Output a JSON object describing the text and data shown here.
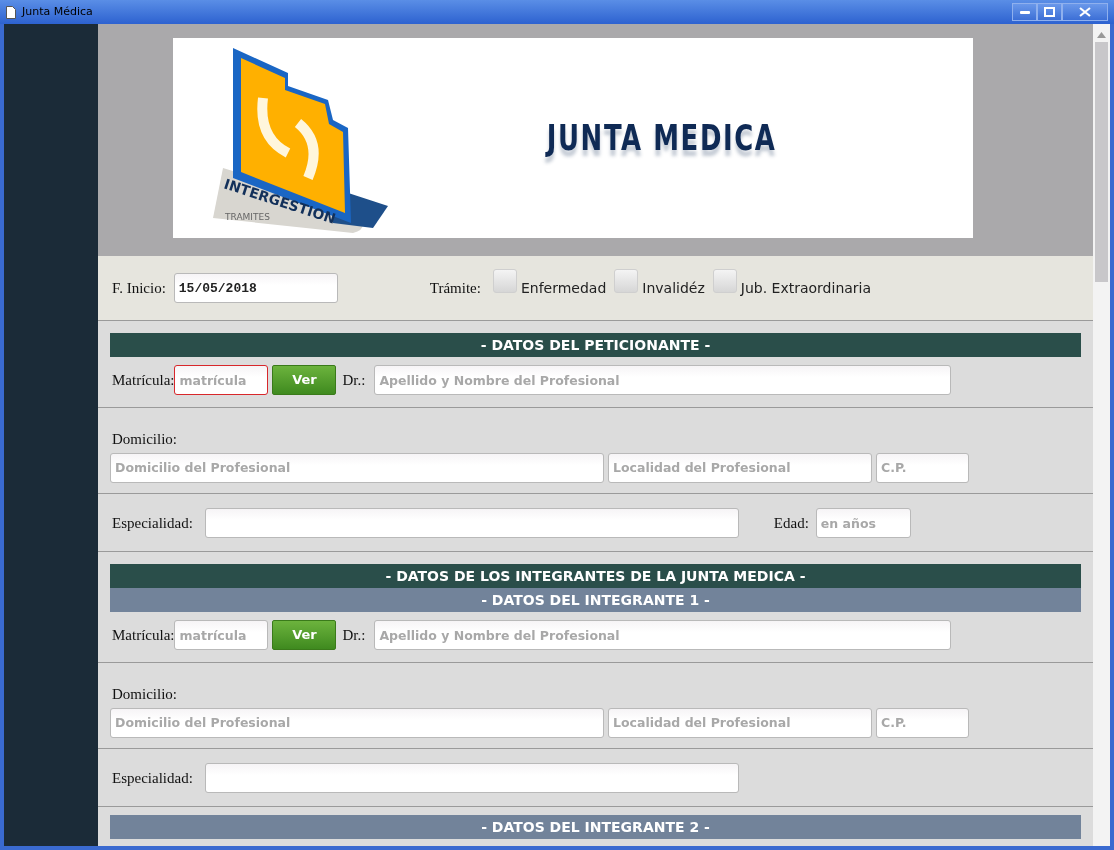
{
  "window": {
    "title": "Junta Médica"
  },
  "banner": {
    "logo_text": "INTERGESTION",
    "logo_subtext": "TRAMITES",
    "title": "JUNTA MEDICA"
  },
  "header": {
    "start_label": "F. Inicio:",
    "start_value": "15/05/2018",
    "tramite_label": "Trámite:",
    "options": [
      {
        "label": "Enfermedad",
        "checked": false
      },
      {
        "label": "Invalidéz",
        "checked": false
      },
      {
        "label": "Jub. Extraordinaria",
        "checked": false
      }
    ]
  },
  "rows": [
    {
      "kind": "matricula",
      "headings": [
        {
          "text": "- DATOS DEL PETICIONANTE -",
          "color": "#2a4e4a"
        }
      ],
      "label": "Matrícula:",
      "placeholder": "matrícula",
      "invalid": true,
      "button": "Ver",
      "dr_label": "Dr.:",
      "name_placeholder": "Apellido y Nombre del Profesional"
    },
    {
      "kind": "address",
      "label": "Domicilio:",
      "placeholders": [
        "Domicilio del Profesional",
        "Localidad del Profesional",
        "C.P."
      ]
    },
    {
      "kind": "specialty",
      "label": "Especialidad:",
      "age_label": "Edad:",
      "age_placeholder": "en años"
    },
    {
      "kind": "matricula",
      "headings": [
        {
          "text": "- DATOS DE LOS INTEGRANTES DE LA JUNTA MEDICA -",
          "color": "#2a4e4a"
        },
        {
          "text": "- DATOS DEL INTEGRANTE 1 -",
          "color": "#72839a"
        }
      ],
      "label": "Matrícula:",
      "placeholder": "matrícula",
      "invalid": false,
      "button": "Ver",
      "dr_label": "Dr.:",
      "name_placeholder": "Apellido y Nombre del Profesional"
    },
    {
      "kind": "address",
      "label": "Domicilio:",
      "placeholders": [
        "Domicilio del Profesional",
        "Localidad del Profesional",
        "C.P."
      ]
    },
    {
      "kind": "specialty",
      "label": "Especialidad:"
    },
    {
      "kind": "headings",
      "headings": [
        {
          "text": "- DATOS DEL INTEGRANTE 2 -",
          "color": "#72839a"
        }
      ]
    }
  ]
}
